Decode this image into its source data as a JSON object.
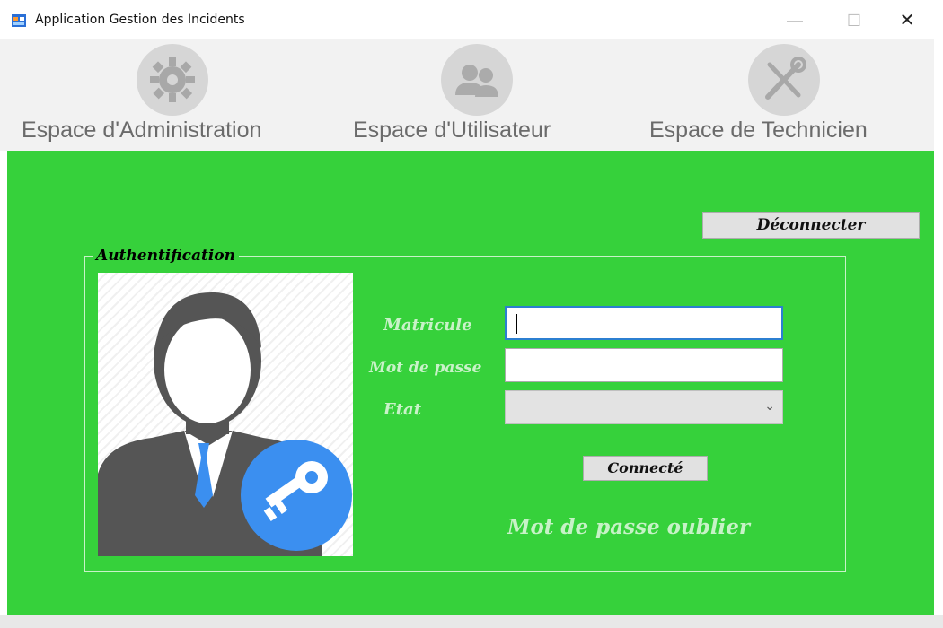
{
  "window": {
    "title": "Application Gestion des Incidents",
    "minimize": "—",
    "maximize": "☐",
    "close": "✕"
  },
  "nav": {
    "admin": {
      "label": "Espace d'Administration",
      "icon": "gear-icon"
    },
    "user": {
      "label": "Espace d'Utilisateur",
      "icon": "users-icon"
    },
    "tech": {
      "label": "Espace de Technicien",
      "icon": "tools-icon"
    }
  },
  "main": {
    "background": "#36d13b",
    "logout_label": "Déconnecter",
    "auth": {
      "legend": "Authentification",
      "matricule_label": "Matricule",
      "matricule_value": "",
      "password_label": "Mot de passe",
      "password_value": "",
      "etat_label": "Etat",
      "etat_value": "",
      "connect_label": "Connecté",
      "forgot_label": "Mot de passe oublier"
    }
  }
}
